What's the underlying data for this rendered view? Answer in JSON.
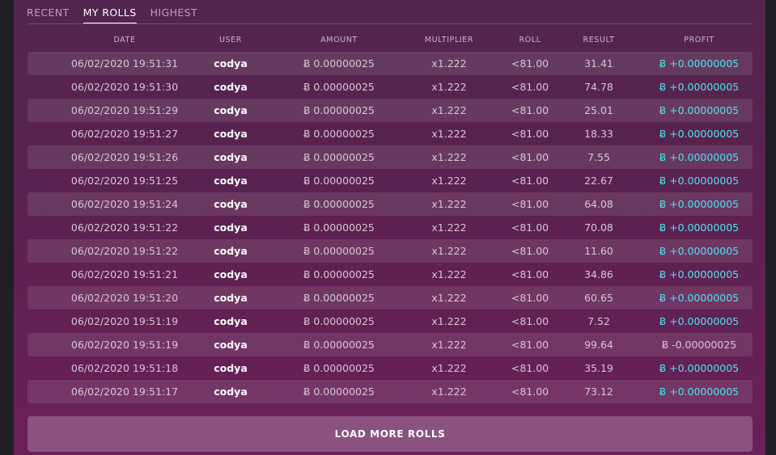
{
  "tabs": [
    "RECENT",
    "MY ROLLS",
    "HIGHEST"
  ],
  "active_tab_index": 1,
  "columns": [
    "DATE",
    "USER",
    "AMOUNT",
    "MULTIPLIER",
    "ROLL",
    "RESULT",
    "PROFIT"
  ],
  "currency_symbol": "Ƀ",
  "colors": {
    "profit_positive": "#4ee4ea",
    "profit_negative": "#d8c7d5"
  },
  "rows": [
    {
      "date": "06/02/2020 19:51:31",
      "user": "codya",
      "amount": "0.00000025",
      "multiplier": "x1.222",
      "roll": "<81.00",
      "result": "31.41",
      "profit": "+0.00000005",
      "win": true
    },
    {
      "date": "06/02/2020 19:51:30",
      "user": "codya",
      "amount": "0.00000025",
      "multiplier": "x1.222",
      "roll": "<81.00",
      "result": "74.78",
      "profit": "+0.00000005",
      "win": true
    },
    {
      "date": "06/02/2020 19:51:29",
      "user": "codya",
      "amount": "0.00000025",
      "multiplier": "x1.222",
      "roll": "<81.00",
      "result": "25.01",
      "profit": "+0.00000005",
      "win": true
    },
    {
      "date": "06/02/2020 19:51:27",
      "user": "codya",
      "amount": "0.00000025",
      "multiplier": "x1.222",
      "roll": "<81.00",
      "result": "18.33",
      "profit": "+0.00000005",
      "win": true
    },
    {
      "date": "06/02/2020 19:51:26",
      "user": "codya",
      "amount": "0.00000025",
      "multiplier": "x1.222",
      "roll": "<81.00",
      "result": "7.55",
      "profit": "+0.00000005",
      "win": true
    },
    {
      "date": "06/02/2020 19:51:25",
      "user": "codya",
      "amount": "0.00000025",
      "multiplier": "x1.222",
      "roll": "<81.00",
      "result": "22.67",
      "profit": "+0.00000005",
      "win": true
    },
    {
      "date": "06/02/2020 19:51:24",
      "user": "codya",
      "amount": "0.00000025",
      "multiplier": "x1.222",
      "roll": "<81.00",
      "result": "64.08",
      "profit": "+0.00000005",
      "win": true
    },
    {
      "date": "06/02/2020 19:51:22",
      "user": "codya",
      "amount": "0.00000025",
      "multiplier": "x1.222",
      "roll": "<81.00",
      "result": "70.08",
      "profit": "+0.00000005",
      "win": true
    },
    {
      "date": "06/02/2020 19:51:22",
      "user": "codya",
      "amount": "0.00000025",
      "multiplier": "x1.222",
      "roll": "<81.00",
      "result": "11.60",
      "profit": "+0.00000005",
      "win": true
    },
    {
      "date": "06/02/2020 19:51:21",
      "user": "codya",
      "amount": "0.00000025",
      "multiplier": "x1.222",
      "roll": "<81.00",
      "result": "34.86",
      "profit": "+0.00000005",
      "win": true
    },
    {
      "date": "06/02/2020 19:51:20",
      "user": "codya",
      "amount": "0.00000025",
      "multiplier": "x1.222",
      "roll": "<81.00",
      "result": "60.65",
      "profit": "+0.00000005",
      "win": true
    },
    {
      "date": "06/02/2020 19:51:19",
      "user": "codya",
      "amount": "0.00000025",
      "multiplier": "x1.222",
      "roll": "<81.00",
      "result": "7.52",
      "profit": "+0.00000005",
      "win": true
    },
    {
      "date": "06/02/2020 19:51:19",
      "user": "codya",
      "amount": "0.00000025",
      "multiplier": "x1.222",
      "roll": "<81.00",
      "result": "99.64",
      "profit": "-0.00000025",
      "win": false
    },
    {
      "date": "06/02/2020 19:51:18",
      "user": "codya",
      "amount": "0.00000025",
      "multiplier": "x1.222",
      "roll": "<81.00",
      "result": "35.19",
      "profit": "+0.00000005",
      "win": true
    },
    {
      "date": "06/02/2020 19:51:17",
      "user": "codya",
      "amount": "0.00000025",
      "multiplier": "x1.222",
      "roll": "<81.00",
      "result": "73.12",
      "profit": "+0.00000005",
      "win": true
    }
  ],
  "load_more_label": "LOAD MORE ROLLS"
}
